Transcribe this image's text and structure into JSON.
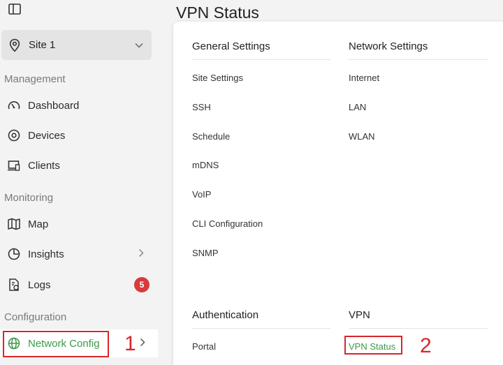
{
  "sidebar": {
    "site_select": {
      "label": "Site 1"
    },
    "sections": {
      "management": "Management",
      "monitoring": "Monitoring",
      "configuration": "Configuration"
    },
    "items": {
      "dashboard": "Dashboard",
      "devices": "Devices",
      "clients": "Clients",
      "map": "Map",
      "insights": "Insights",
      "logs": "Logs",
      "network_config": "Network Config"
    },
    "logs_badge": "5"
  },
  "main": {
    "title": "VPN Status",
    "groups": {
      "general": {
        "title": "General Settings",
        "links": [
          "Site Settings",
          "SSH",
          "Schedule",
          "mDNS",
          "VoIP",
          "CLI Configuration",
          "SNMP"
        ]
      },
      "network": {
        "title": "Network Settings",
        "links": [
          "Internet",
          "LAN",
          "WLAN"
        ]
      },
      "authentication": {
        "title": "Authentication",
        "links": [
          "Portal"
        ]
      },
      "vpn": {
        "title": "VPN",
        "links": [
          "VPN Status"
        ]
      }
    }
  },
  "annotations": {
    "step1": "1",
    "step2": "2"
  },
  "colors": {
    "accent": "#3a9a46",
    "badge": "#d93a3a",
    "annotation": "#d9262b"
  }
}
